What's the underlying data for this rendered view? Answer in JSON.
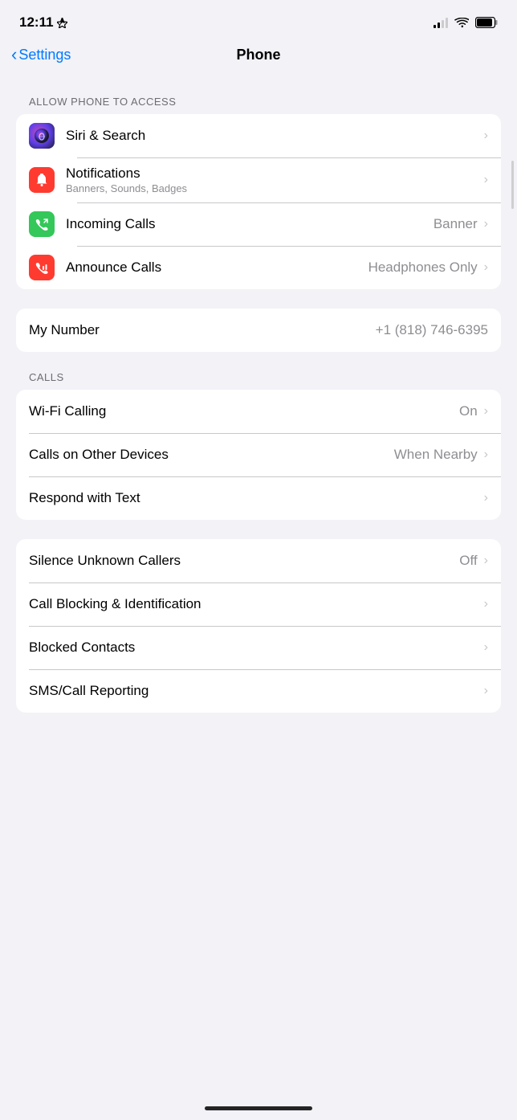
{
  "statusBar": {
    "time": "12:11",
    "locationIcon": "◂",
    "batteryLevel": 85
  },
  "header": {
    "backLabel": "Settings",
    "title": "Phone"
  },
  "sections": [
    {
      "label": "ALLOW PHONE TO ACCESS",
      "id": "allow-access",
      "rows": [
        {
          "id": "siri-search",
          "icon": "siri",
          "title": "Siri & Search",
          "subtitle": null,
          "value": null,
          "chevron": true
        },
        {
          "id": "notifications",
          "icon": "notif",
          "title": "Notifications",
          "subtitle": "Banners, Sounds, Badges",
          "value": null,
          "chevron": true
        },
        {
          "id": "incoming-calls",
          "icon": "incoming",
          "title": "Incoming Calls",
          "subtitle": null,
          "value": "Banner",
          "chevron": true
        },
        {
          "id": "announce-calls",
          "icon": "announce",
          "title": "Announce Calls",
          "subtitle": null,
          "value": "Headphones Only",
          "chevron": true
        }
      ]
    },
    {
      "label": null,
      "id": "my-number",
      "rows": [
        {
          "id": "my-number",
          "icon": null,
          "title": "My Number",
          "subtitle": null,
          "value": "+1 (818) 746-6395",
          "chevron": false
        }
      ]
    },
    {
      "label": "CALLS",
      "id": "calls",
      "rows": [
        {
          "id": "wifi-calling",
          "icon": null,
          "title": "Wi-Fi Calling",
          "subtitle": null,
          "value": "On",
          "chevron": true
        },
        {
          "id": "calls-other-devices",
          "icon": null,
          "title": "Calls on Other Devices",
          "subtitle": null,
          "value": "When Nearby",
          "chevron": true
        },
        {
          "id": "respond-with-text",
          "icon": null,
          "title": "Respond with Text",
          "subtitle": null,
          "value": null,
          "chevron": true
        }
      ]
    },
    {
      "label": null,
      "id": "blocking",
      "rows": [
        {
          "id": "silence-unknown",
          "icon": null,
          "title": "Silence Unknown Callers",
          "subtitle": null,
          "value": "Off",
          "chevron": true
        },
        {
          "id": "call-blocking",
          "icon": null,
          "title": "Call Blocking & Identification",
          "subtitle": null,
          "value": null,
          "chevron": true
        },
        {
          "id": "blocked-contacts",
          "icon": null,
          "title": "Blocked Contacts",
          "subtitle": null,
          "value": null,
          "chevron": true
        },
        {
          "id": "sms-call-reporting",
          "icon": null,
          "title": "SMS/Call Reporting",
          "subtitle": null,
          "value": null,
          "chevron": true
        }
      ]
    }
  ]
}
